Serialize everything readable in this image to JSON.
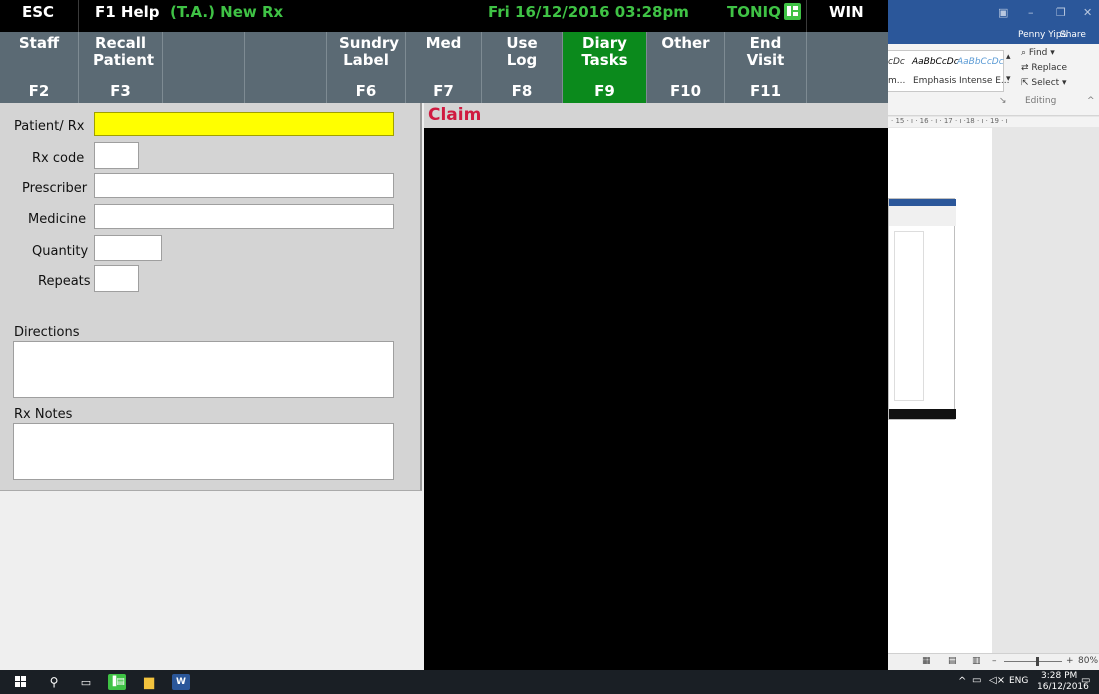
{
  "titlebar": {
    "esc": "ESC",
    "f1": "F1 Help",
    "mode": "(T.A.) New Rx",
    "datetime": "Fri 16/12/2016 03:28pm",
    "brand": "TONIQ",
    "win": "WIN"
  },
  "fkeys": [
    {
      "label": "Staff",
      "key": "F2"
    },
    {
      "label": "Recall Patient",
      "key": "F3"
    },
    {
      "label": "",
      "key": ""
    },
    {
      "label": "",
      "key": ""
    },
    {
      "label": "Sundry Label",
      "key": "F6"
    },
    {
      "label": "Med",
      "key": "F7"
    },
    {
      "label": "Use Log",
      "key": "F8"
    },
    {
      "label": "Diary Tasks",
      "key": "F9"
    },
    {
      "label": "Other",
      "key": "F10"
    },
    {
      "label": "End Visit",
      "key": "F11"
    },
    {
      "label": "",
      "key": ""
    }
  ],
  "form": {
    "patient_label": "Patient/ Rx",
    "patient_value": "",
    "rxcode_label": "Rx code",
    "rxcode_value": "",
    "prescriber_label": "Prescriber",
    "prescriber_value": "",
    "medicine_label": "Medicine",
    "medicine_value": "",
    "quantity_label": "Quantity",
    "quantity_value": "",
    "repeats_label": "Repeats",
    "repeats_value": "",
    "directions_label": "Directions",
    "directions_value": "",
    "rxnotes_label": "Rx Notes",
    "rxnotes_value": ""
  },
  "claim": {
    "title": "Claim"
  },
  "word": {
    "user": "Penny Yip",
    "share": "Share",
    "styles": [
      "cDc",
      "AaBbCcDc",
      "AaBbCcDc"
    ],
    "style_names": [
      "m...",
      "Emphasis",
      "Intense E..."
    ],
    "find": "Find",
    "replace": "Replace",
    "select": "Select",
    "editing": "Editing",
    "ruler": "· 15 · ı · 16 · ı · 17 · ı ·18 · ı · 19 · ı",
    "zoom": "80%"
  },
  "taskbar": {
    "lang": "ENG",
    "time": "3:28 PM",
    "date": "16/12/2016"
  },
  "colors": {
    "highlight": "#ffff00",
    "active_key": "#0b8a1c",
    "claim_red": "#d01a40",
    "brand_green": "#3fc245"
  }
}
